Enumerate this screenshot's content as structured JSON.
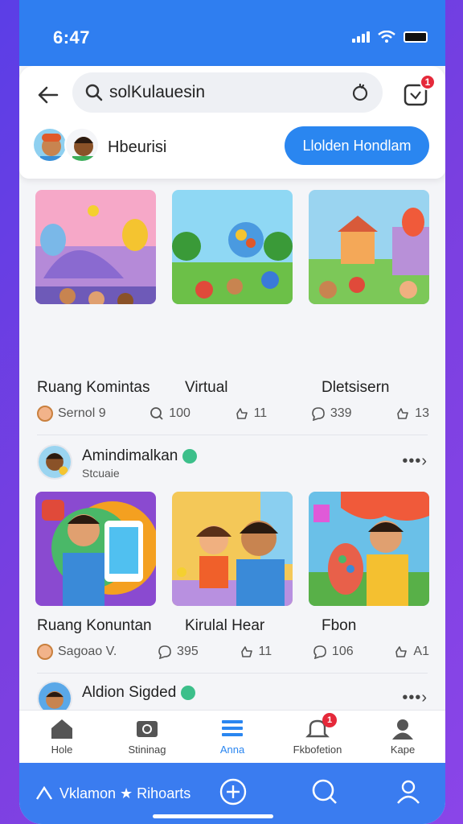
{
  "status": {
    "time": "6:47"
  },
  "search": {
    "value": "solKulauesin"
  },
  "header": {
    "group_label": "Hbeurisi",
    "join_button": "Llolden Hondlam",
    "notif_count": "1"
  },
  "row1": {
    "captions": [
      "Ruang Komintas",
      "Virtual",
      "Dletsisern"
    ],
    "stats": {
      "author": "Sernol 9",
      "views": "100",
      "likes1": "11",
      "comments": "339",
      "likes2": "13"
    }
  },
  "post2": {
    "name": "Amindimalkan",
    "subtitle": "Stcuaie",
    "more": "•••›",
    "captions": [
      "Ruang Konuntan",
      "Kirulal Hear",
      "Fbon"
    ],
    "stats": {
      "author": "Sagoao V.",
      "comments": "395",
      "likes1": "11",
      "comments2": "106",
      "likes2": "A1"
    }
  },
  "post3": {
    "name": "Aldion Sigded",
    "more": "•••›"
  },
  "nav": {
    "items": [
      {
        "label": "Hole",
        "icon": "home-icon"
      },
      {
        "label": "Stininag",
        "icon": "camera-icon"
      },
      {
        "label": "Anna",
        "icon": "list-icon"
      },
      {
        "label": "Fkbofetion",
        "icon": "bell-icon",
        "badge": "1"
      },
      {
        "label": "Kape",
        "icon": "profile-icon"
      }
    ]
  },
  "action_bar": {
    "link_label": "Vklamon ★ Rihoarts"
  },
  "colors": {
    "primary": "#2a86f0",
    "accent_red": "#e5293a",
    "bar_blue": "#3a7cf0"
  }
}
